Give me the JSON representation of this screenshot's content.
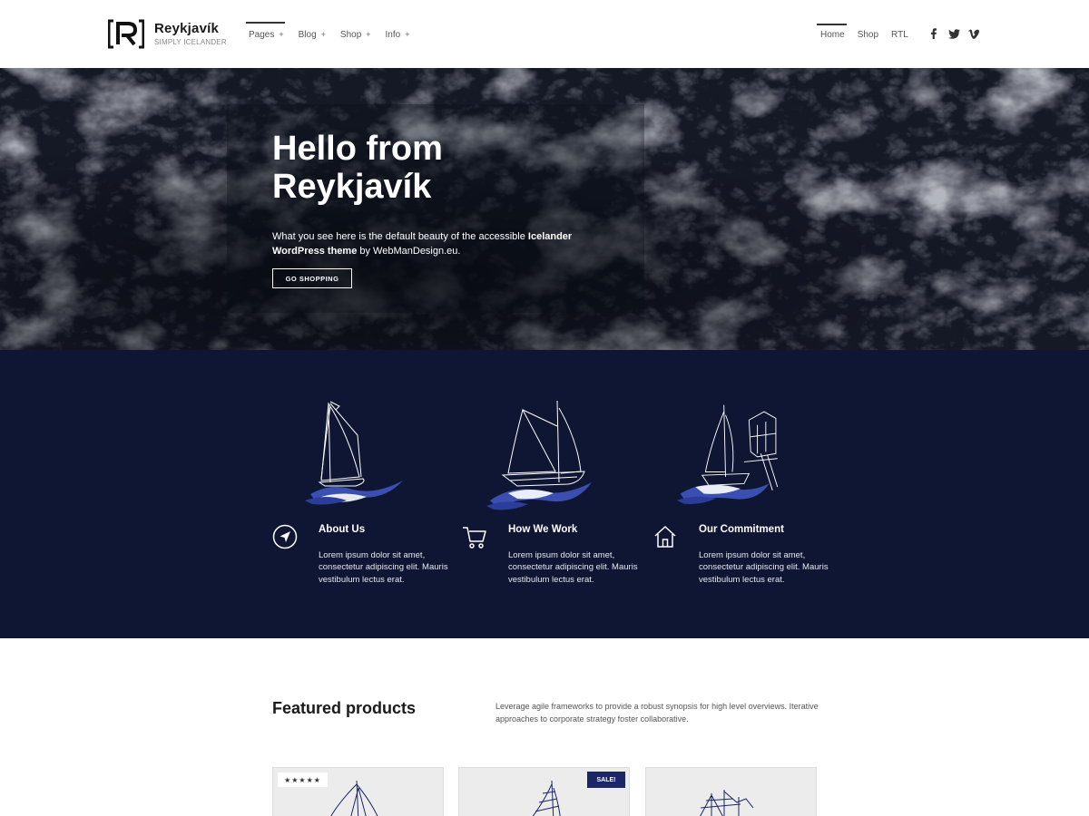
{
  "header": {
    "brand_name": "Reykjavík",
    "brand_tagline": "SIMPLY ICELANDER",
    "nav_left": [
      {
        "label": "Pages",
        "plus": "+"
      },
      {
        "label": "Blog",
        "plus": "+"
      },
      {
        "label": "Shop",
        "plus": "+"
      },
      {
        "label": "Info",
        "plus": "+"
      }
    ],
    "nav_right": [
      {
        "label": "Home"
      },
      {
        "label": "Shop"
      },
      {
        "label": "RTL"
      }
    ],
    "social": [
      "facebook-icon",
      "twitter-icon",
      "vimeo-icon"
    ]
  },
  "hero": {
    "title_line1": "Hello from",
    "title_line2": "Reykjavík",
    "text_1": "What you see here is the default beauty of the accessible ",
    "text_bold": "Icelander WordPress theme",
    "text_2": " by WebManDesign.eu.",
    "button": "GO SHOPPING"
  },
  "features": [
    {
      "title": "About Us",
      "text": "Lorem ipsum dolor sit amet, consectetur adipiscing elit. Mauris vestibulum lectus erat.",
      "icon": "compass-icon"
    },
    {
      "title": "How We Work",
      "text": "Lorem ipsum dolor sit amet, consectetur adipiscing elit. Mauris vestibulum lectus erat.",
      "icon": "cart-icon"
    },
    {
      "title": "Our Commitment",
      "text": "Lorem ipsum dolor sit amet, consectetur adipiscing elit. Mauris vestibulum lectus erat.",
      "icon": "home-icon"
    }
  ],
  "featured": {
    "title": "Featured products",
    "description": "Leverage agile frameworks to provide a robust synopsis for high level overviews. Iterative approaches to corporate strategy foster collaborative.",
    "products": [
      {
        "badge": "★★★★★"
      },
      {
        "badge": "SALE!"
      },
      {
        "badge": ""
      }
    ]
  },
  "colors": {
    "hero_bg": "#0f1220",
    "features_bg": "#0e1633",
    "accent_blue": "#3a4fb0",
    "sale_badge": "#1a2666"
  }
}
